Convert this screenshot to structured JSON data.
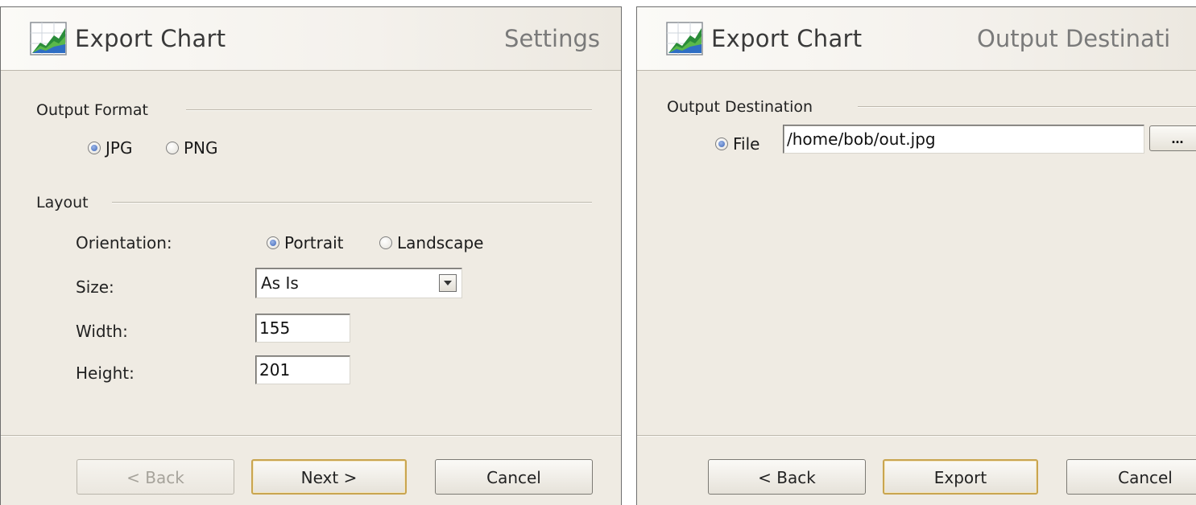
{
  "colors": {
    "dialog_bg": "#efebe3",
    "accent_default_button": "#c9a550",
    "radio_fill": "#3f66b8"
  },
  "settings_dialog": {
    "title": "Export Chart",
    "step": "Settings",
    "icon": "chart-icon",
    "output_format": {
      "label": "Output Format",
      "options": [
        {
          "label": "JPG",
          "selected": true
        },
        {
          "label": "PNG",
          "selected": false
        }
      ]
    },
    "layout": {
      "label": "Layout",
      "orientation_label": "Orientation:",
      "orientation_options": [
        {
          "label": "Portrait",
          "selected": true
        },
        {
          "label": "Landscape",
          "selected": false
        }
      ],
      "size_label": "Size:",
      "size_value": "As Is",
      "width_label": "Width:",
      "width_value": "155",
      "height_label": "Height:",
      "height_value": "201"
    },
    "buttons": {
      "back": "< Back",
      "next": "Next >",
      "cancel": "Cancel"
    }
  },
  "destination_dialog": {
    "title": "Export Chart",
    "step": "Output Destinati",
    "icon": "chart-icon",
    "output_destination": {
      "label": "Output Destination",
      "file_label": "File",
      "file_selected": true,
      "file_path": "/home/bob/out.jpg",
      "browse_label": "..."
    },
    "buttons": {
      "back": "< Back",
      "export": "Export",
      "cancel": "Cancel"
    }
  }
}
